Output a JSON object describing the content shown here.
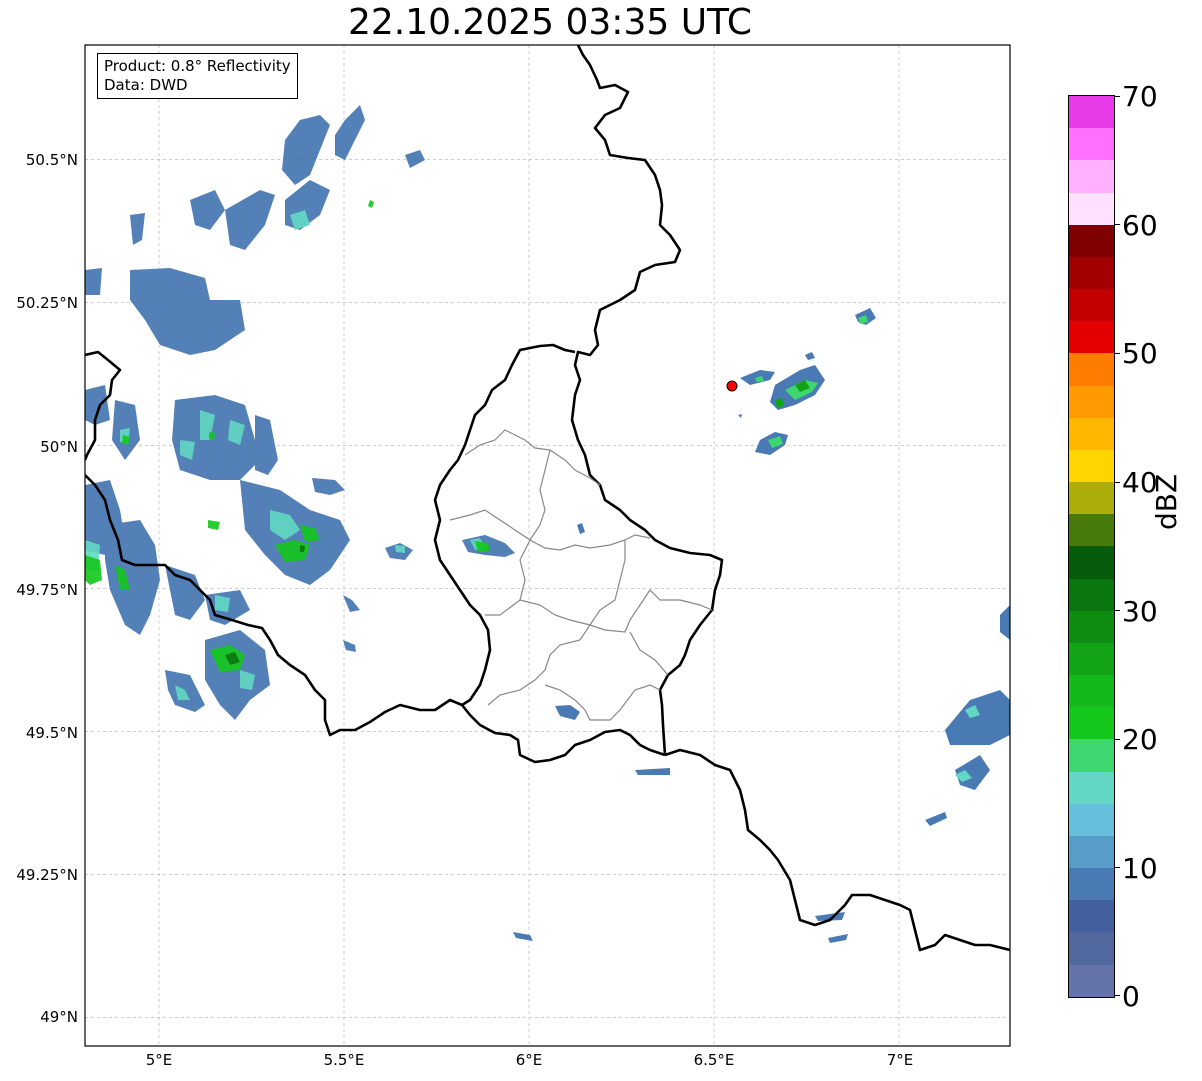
{
  "title": "22.10.2025 03:35 UTC",
  "info_box": {
    "product": "Product: 0.8° Reflectivity",
    "data": "Data: DWD"
  },
  "map": {
    "lon_range": [
      4.8,
      7.3
    ],
    "lat_range": [
      48.95,
      50.7
    ],
    "lat_labels": [
      "50.5°N",
      "50.25°N",
      "50°N",
      "49.75°N",
      "49.5°N",
      "49.25°N",
      "49°N"
    ],
    "lat_values": [
      50.5,
      50.25,
      50.0,
      49.75,
      49.5,
      49.25,
      49.0
    ],
    "lon_labels": [
      "5°E",
      "5.5°E",
      "6°E",
      "6.5°E",
      "7°E"
    ],
    "lon_values": [
      5.0,
      5.5,
      6.0,
      6.5,
      7.0
    ],
    "gridlines": true,
    "radar_site_color": "#ff0000"
  },
  "colorbar": {
    "label": "dBZ",
    "ticks": [
      "0",
      "10",
      "20",
      "30",
      "40",
      "50",
      "60",
      "70"
    ],
    "min": 0,
    "max": 70,
    "colors": [
      "#6474a8",
      "#5269a0",
      "#44609f",
      "#4a7ab3",
      "#589dc7",
      "#67c0db",
      "#62d8c4",
      "#3ed66f",
      "#13c81b",
      "#13b81b",
      "#12a316",
      "#0f8c12",
      "#0b7510",
      "#075c0c",
      "#467a0c",
      "#abae0a",
      "#ffd500",
      "#ffb700",
      "#ff9b00",
      "#ff7c00",
      "#e40000",
      "#c20000",
      "#a10000",
      "#7f0000",
      "#ffe0ff",
      "#ffb0ff",
      "#ff70ff",
      "#e83ae8"
    ]
  }
}
